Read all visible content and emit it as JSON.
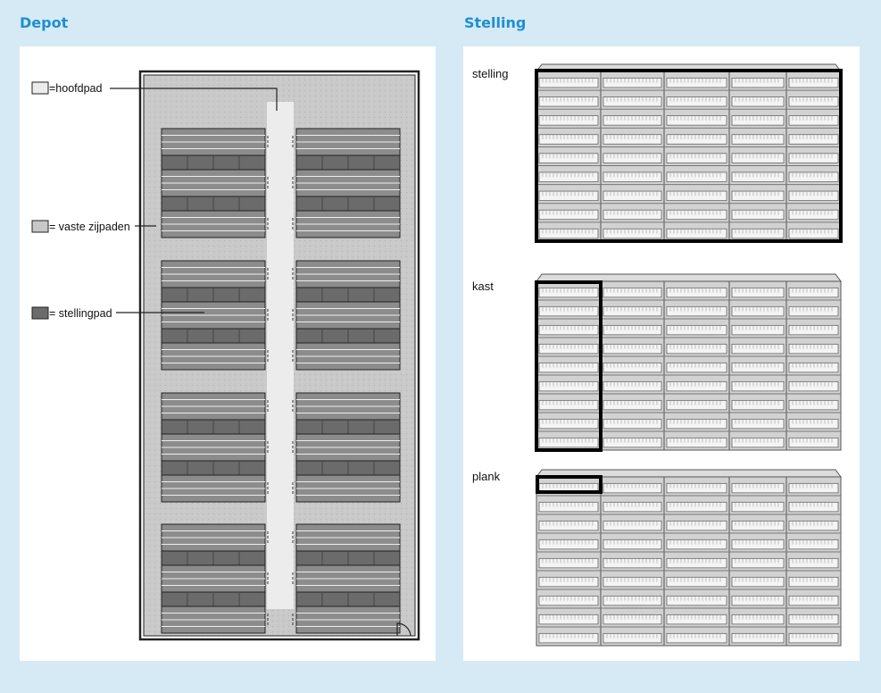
{
  "depot": {
    "title": "Depot",
    "legend": {
      "hoofdpad": "=hoofdpad",
      "vaste_zijpaden": "= vaste zijpaden",
      "stellingpad": "= stellingpad"
    }
  },
  "stelling": {
    "title": "Stelling",
    "labels": {
      "stelling": "stelling",
      "kast": "kast",
      "plank": "plank"
    }
  },
  "colors": {
    "background": "#d6eaf6",
    "heading": "#1e8fd0",
    "hoofdpad": "#ececec",
    "vaste_zijpaden": "#c8c8c8",
    "stellingpad": "#6b6b6b",
    "highlight": "#000000"
  }
}
